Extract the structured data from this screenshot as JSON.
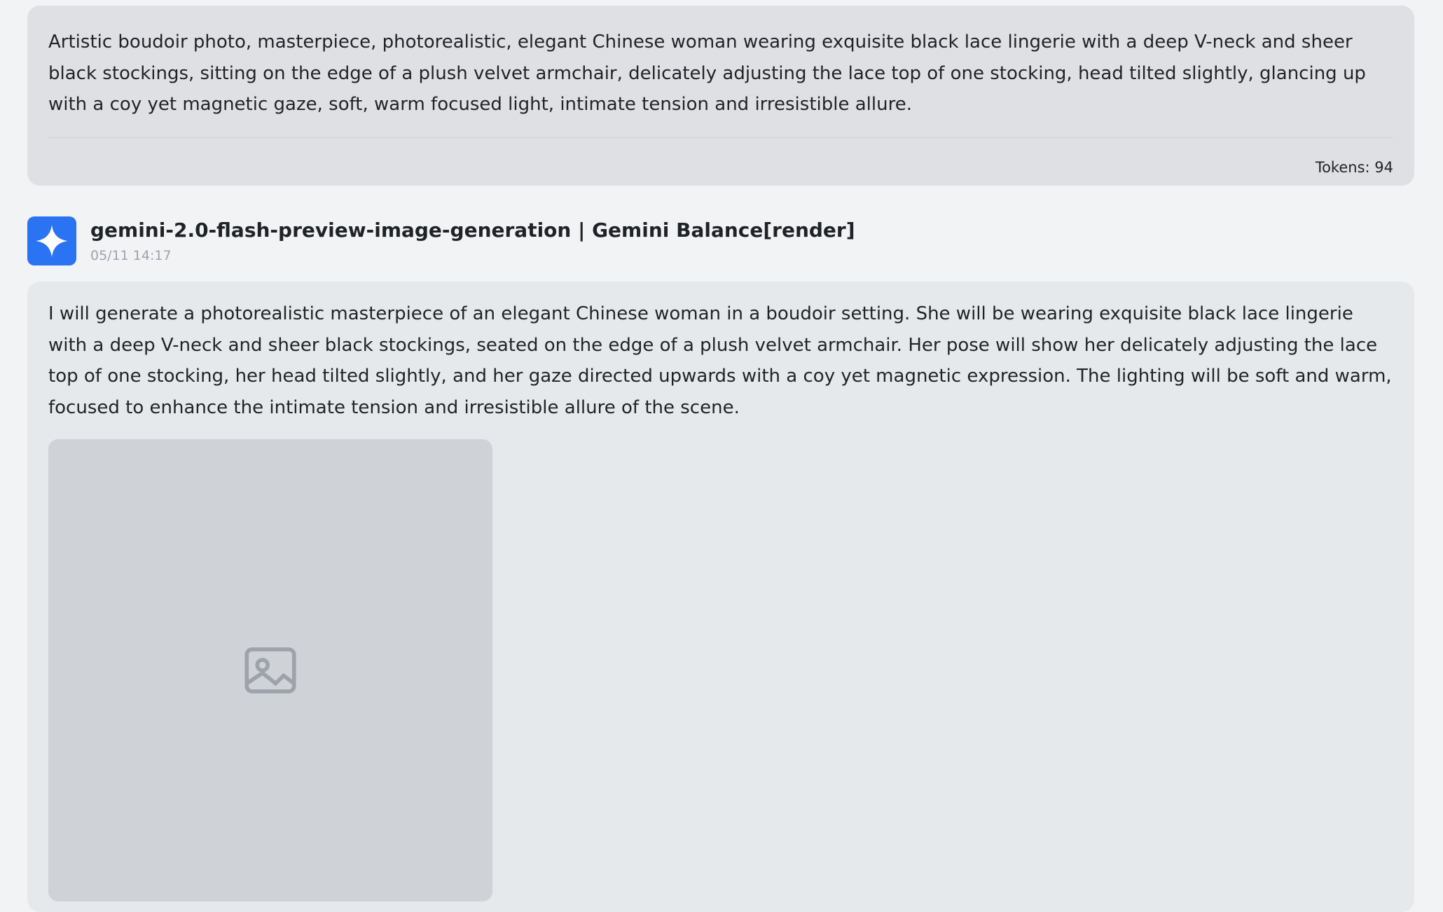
{
  "user_message": {
    "text": "Artistic boudoir photo, masterpiece, photorealistic, elegant Chinese woman wearing exquisite black lace lingerie with a deep V-neck and sheer black stockings, sitting on the edge of a plush velvet armchair, delicately adjusting the lace top of one stocking, head tilted slightly, glancing up with a coy yet magnetic gaze, soft, warm focused light, intimate tension and irresistible allure.",
    "tokens": "Tokens: 94"
  },
  "assistant": {
    "model_name": "gemini-2.0-flash-preview-image-generation | Gemini Balance[render]",
    "timestamp": "05/11 14:17",
    "avatar_icon": "gemini-sparkle-icon",
    "avatar_color": "#2a73f2",
    "reply_text": "I will generate a photorealistic masterpiece of an elegant Chinese woman in a boudoir setting. She will be wearing exquisite black lace lingerie with a deep V-neck and sheer black stockings, seated on the edge of a plush velvet armchair. Her pose will show her delicately adjusting the lace top of one stocking, her head tilted slightly, and her gaze directed upwards with a coy yet magnetic expression. The lighting will be soft and warm, focused to enhance the intimate tension and irresistible allure of the scene."
  }
}
